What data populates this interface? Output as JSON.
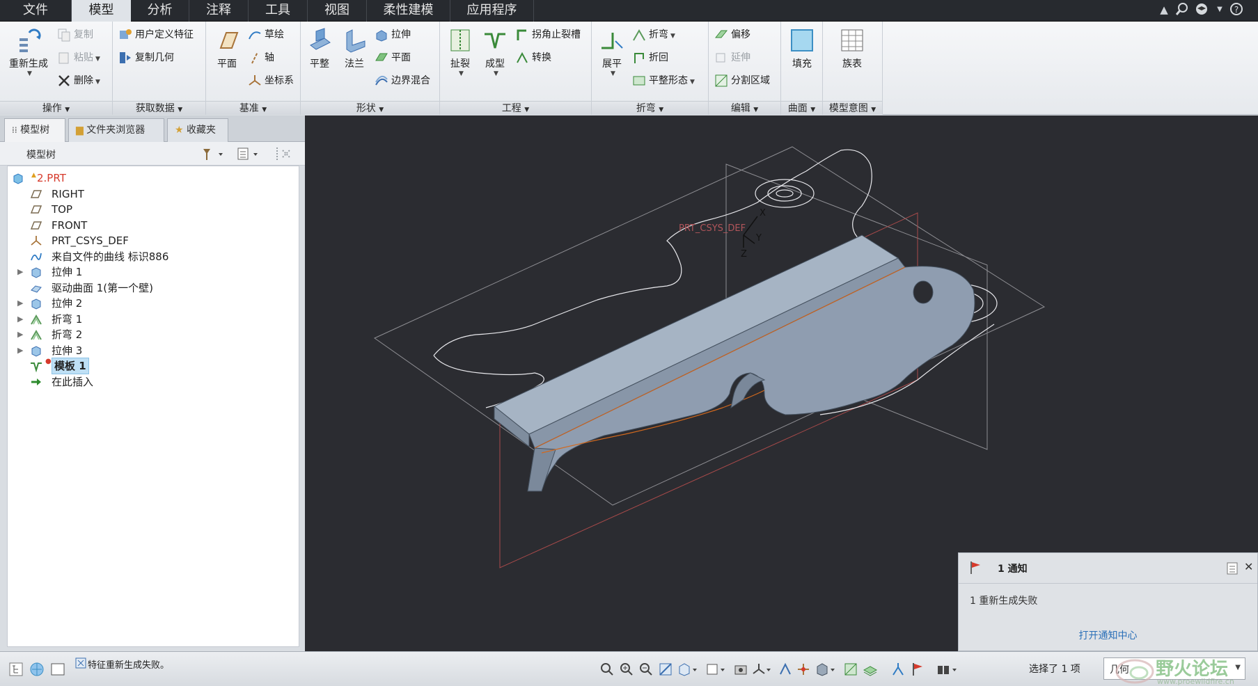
{
  "menu": {
    "tabs": [
      "文件",
      "模型",
      "分析",
      "注释",
      "工具",
      "视图",
      "柔性建模",
      "应用程序"
    ],
    "active": "模型"
  },
  "ribbon": {
    "ops": {
      "regen": "重新生成",
      "copy": "复制",
      "paste": "粘贴",
      "delete": "删除",
      "label": "操作"
    },
    "getdata": {
      "udf": "用户定义特征",
      "copygeom": "复制几何",
      "label": "获取数据"
    },
    "datum": {
      "plane": "平面",
      "sketch": "草绘",
      "axis": "轴",
      "csys": "坐标系",
      "label": "基准"
    },
    "shapes": {
      "flat": "平整",
      "flange": "法兰",
      "extrude": "拉伸",
      "planar": "平面",
      "blend": "边界混合",
      "label": "形状"
    },
    "eng": {
      "rip": "扯裂",
      "form": "成型",
      "relief": "拐角止裂槽",
      "convert": "转换",
      "label": "工程"
    },
    "bends": {
      "unbend": "展平",
      "bend": "折弯",
      "bendback": "折回",
      "flatform": "平整形态",
      "label": "折弯"
    },
    "edit": {
      "offset": "偏移",
      "extend": "延伸",
      "split": "分割区域",
      "label": "编辑"
    },
    "surface": {
      "fill": "填充",
      "label": "曲面"
    },
    "intent": {
      "family": "族表",
      "label": "模型意图"
    }
  },
  "leftpanel": {
    "tabs": [
      "模型树",
      "文件夹浏览器",
      "收藏夹"
    ],
    "header": "模型树"
  },
  "tree": [
    {
      "label": "2.PRT",
      "icon": "part-icon",
      "expand": false,
      "warn": true
    },
    {
      "label": "RIGHT",
      "icon": "datum-plane-icon",
      "expand": false
    },
    {
      "label": "TOP",
      "icon": "datum-plane-icon",
      "expand": false
    },
    {
      "label": "FRONT",
      "icon": "datum-plane-icon",
      "expand": false
    },
    {
      "label": "PRT_CSYS_DEF",
      "icon": "csys-icon",
      "expand": false
    },
    {
      "label": "来自文件的曲线 标识886",
      "icon": "curve-icon",
      "expand": false
    },
    {
      "label": "拉伸 1",
      "icon": "extrude-icon",
      "expand": true
    },
    {
      "label": "驱动曲面 1(第一个壁)",
      "icon": "surface-icon",
      "expand": false
    },
    {
      "label": "拉伸 2",
      "icon": "extrude-icon",
      "expand": true
    },
    {
      "label": "折弯 1",
      "icon": "bend-icon",
      "expand": true
    },
    {
      "label": "折弯 2",
      "icon": "bend-icon",
      "expand": true
    },
    {
      "label": "拉伸 3",
      "icon": "extrude-icon",
      "expand": true
    },
    {
      "label": "模板 1",
      "icon": "form-icon",
      "expand": false,
      "selected": true,
      "error": true
    },
    {
      "label": "在此插入",
      "icon": "insert-arrow-icon",
      "expand": false
    }
  ],
  "viewport": {
    "csys_label": "PRT_CSYS_DEF",
    "axis_x": "X",
    "axis_y": "Y",
    "axis_z": "Z"
  },
  "notification": {
    "title": "1 通知",
    "message": "1 重新生成失败",
    "link": "打开通知中心"
  },
  "status": {
    "message": "特征重新生成失败。",
    "selection": "选择了 1 项",
    "filter": "几何",
    "watermark": "野火论坛",
    "watermark_url": "www.proewildfire.cn"
  },
  "colors": {
    "accent_error": "#d63a2c",
    "part": "#9aa8b8",
    "viewport_bg": "#2b2c31"
  }
}
